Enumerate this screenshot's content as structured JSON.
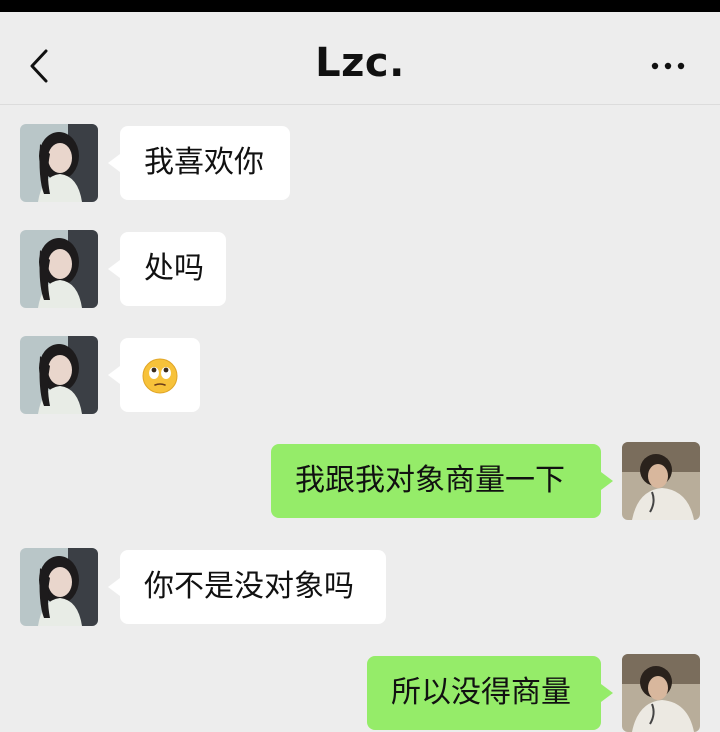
{
  "header": {
    "title": "Lzc.",
    "back_icon": "chevron-left-icon",
    "more_icon": "more-dots-icon"
  },
  "messages": [
    {
      "sender": "contact",
      "text": "我喜欢你"
    },
    {
      "sender": "contact",
      "text": "处吗"
    },
    {
      "sender": "contact",
      "emoji": "face-with-rolling-eyes-emoji"
    },
    {
      "sender": "me",
      "text": "我跟我对象商量一下"
    },
    {
      "sender": "contact",
      "text": "你不是没对象吗"
    },
    {
      "sender": "me",
      "text": "所以没得商量"
    }
  ],
  "colors": {
    "background": "#ededed",
    "incoming_bubble": "#ffffff",
    "outgoing_bubble": "#95ec69"
  }
}
